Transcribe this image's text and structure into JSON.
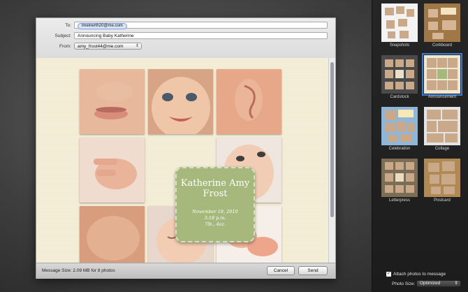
{
  "header": {
    "to_label": "To:",
    "to_recipient": "lmeinerth20@me.com",
    "subject_label": "Subject:",
    "subject_value": "Announcing Baby Katherine",
    "from_label": "From:",
    "from_value": "amy_frost44@me.com"
  },
  "card": {
    "name": "Katherine Amy Frost",
    "date_line1": "November 18, 2010",
    "date_line2": "3:18 p.m.",
    "date_line3": "7lb., 4oz."
  },
  "footer": {
    "message_size": "Message Size: 2.09 MB for 8 photos",
    "cancel_label": "Cancel",
    "send_label": "Send"
  },
  "themes": [
    {
      "label": "Snapshots"
    },
    {
      "label": "Corkboard"
    },
    {
      "label": "Cardstock"
    },
    {
      "label": "Announcement"
    },
    {
      "label": "Celebration"
    },
    {
      "label": "Collage"
    },
    {
      "label": "Letterpress"
    },
    {
      "label": "Postcard"
    }
  ],
  "options": {
    "attach_label": "Attach photos to message",
    "attach_checked": true,
    "photo_size_label": "Photo Size:",
    "photo_size_value": "Optimized"
  },
  "colors": {
    "selected_theme_outline": "#3a7bd5",
    "card_green": "#a7b87c",
    "paper": "#f1ecd3"
  }
}
